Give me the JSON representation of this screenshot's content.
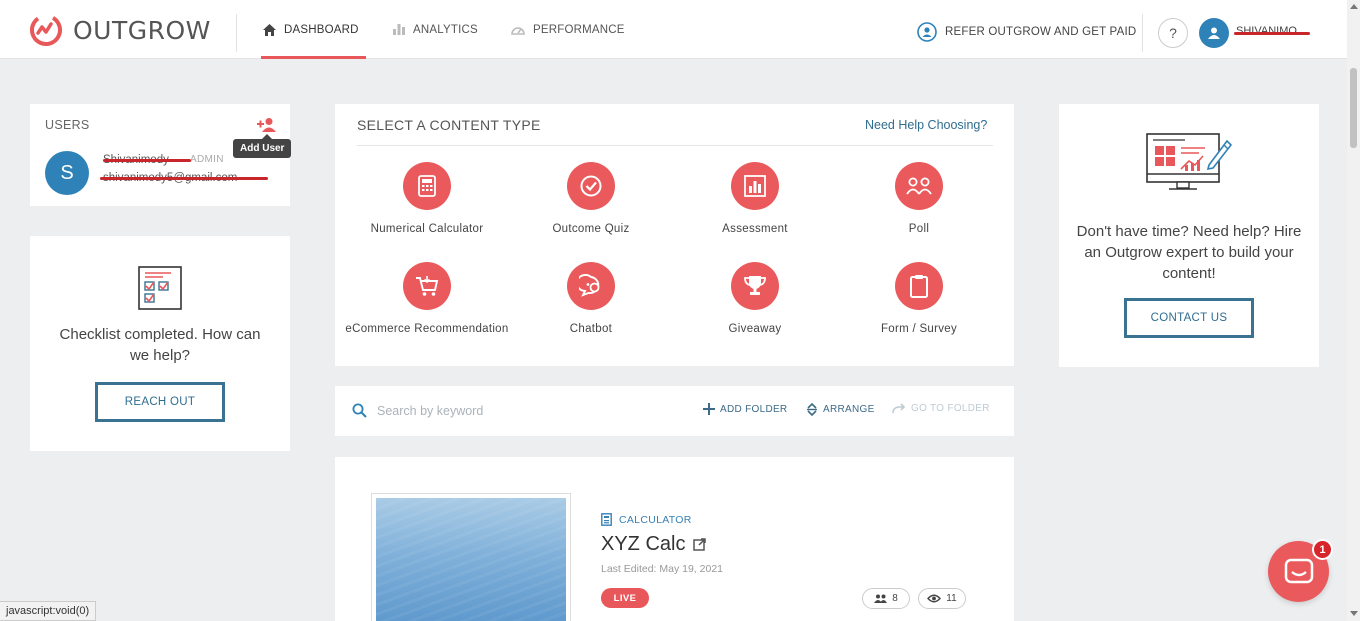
{
  "app": {
    "logo_text": "OUTGROW",
    "brand_color": "#e8585a",
    "accent_color": "#2f6d8f"
  },
  "nav": {
    "items": [
      {
        "label": "DASHBOARD",
        "icon": "home-icon",
        "active": true
      },
      {
        "label": "ANALYTICS",
        "icon": "bar-chart-icon",
        "active": false
      },
      {
        "label": "PERFORMANCE",
        "icon": "gauge-icon",
        "active": false
      }
    ],
    "refer_label": "REFER OUTGROW AND GET PAID",
    "help_label": "?",
    "username": "SHIVANIMO"
  },
  "users": {
    "title": "USERS",
    "add_user_tooltip": "Add User",
    "user": {
      "initial": "S",
      "name": "Shivanimody",
      "role": "ADMIN",
      "email": "shivanimody5@gmail.com"
    }
  },
  "checklist": {
    "text": "Checklist completed. How can we help?",
    "button": "REACH OUT"
  },
  "content_types": {
    "title": "SELECT A CONTENT TYPE",
    "help_link": "Need Help Choosing?",
    "items": [
      {
        "label": "Numerical Calculator",
        "icon": "calculator-icon"
      },
      {
        "label": "Outcome Quiz",
        "icon": "check-circle-icon"
      },
      {
        "label": "Assessment",
        "icon": "bar-chart-icon"
      },
      {
        "label": "Poll",
        "icon": "people-icon"
      },
      {
        "label": "eCommerce Recommendation",
        "icon": "cart-icon"
      },
      {
        "label": "Chatbot",
        "icon": "chat-icon"
      },
      {
        "label": "Giveaway",
        "icon": "trophy-icon"
      },
      {
        "label": "Form / Survey",
        "icon": "clipboard-icon"
      }
    ]
  },
  "search": {
    "placeholder": "Search by keyword",
    "add_folder": "ADD FOLDER",
    "arrange": "ARRANGE",
    "go_to_folder": "GO TO FOLDER"
  },
  "project": {
    "type": "CALCULATOR",
    "title": "XYZ Calc",
    "last_edited": "Last Edited: May 19, 2021",
    "status": "LIVE",
    "leads": "8",
    "views": "11"
  },
  "expert": {
    "text": "Don't have time? Need help? Hire an Outgrow expert to build your content!",
    "button": "CONTACT US"
  },
  "chat": {
    "badge_count": "1"
  },
  "status_bar": {
    "text": "javascript:void(0)"
  }
}
